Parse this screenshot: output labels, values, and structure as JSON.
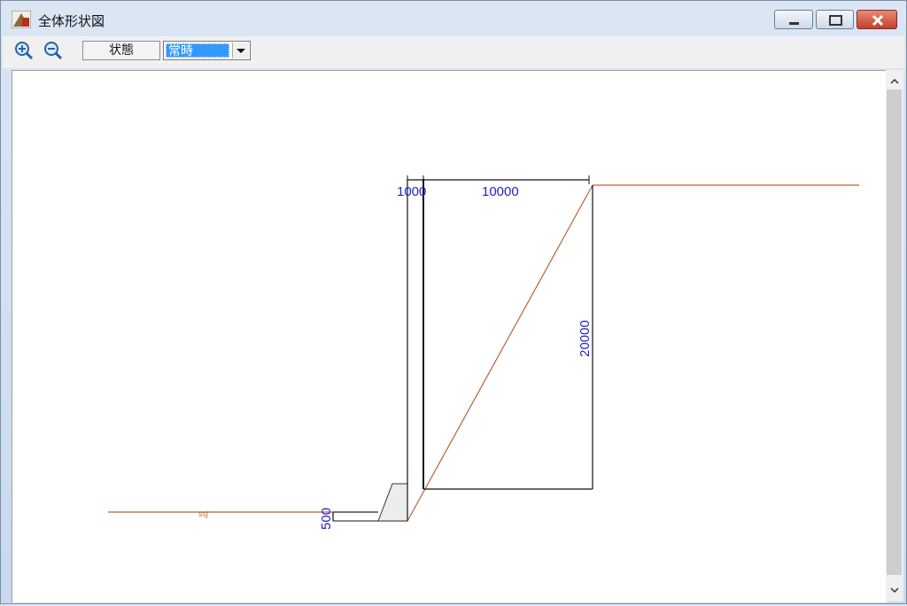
{
  "window": {
    "title": "全体形状図"
  },
  "toolbar": {
    "zoom_in": "zoom-in-icon",
    "zoom_out": "zoom-out-icon",
    "state_label": "状態",
    "state_value": "常時"
  },
  "drawing": {
    "dim_left": "1000",
    "dim_top": "10000",
    "dim_height": "20000",
    "dim_bottom": "500"
  },
  "colors": {
    "ground_line": "#b5643b",
    "dimension_text": "#2323c8",
    "accent_selection": "#3399ff"
  }
}
